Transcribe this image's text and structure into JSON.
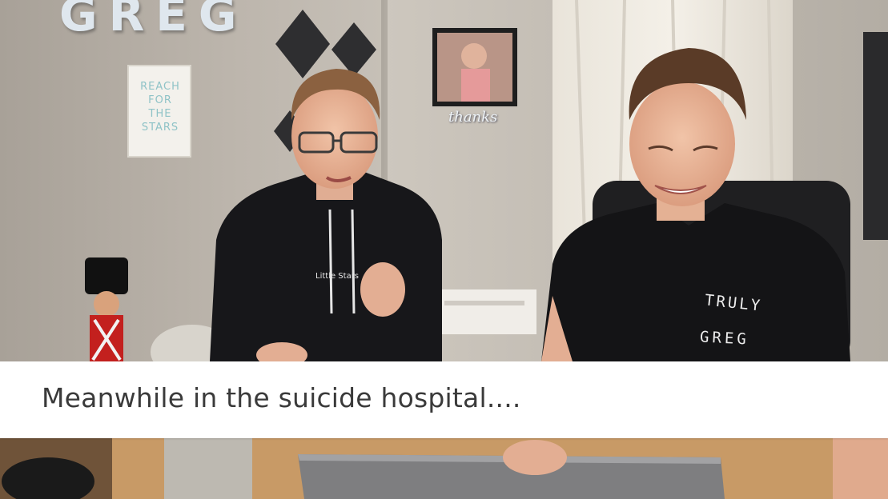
{
  "wall_letters": "GREG",
  "poster_text": "REACH FOR THE STARS",
  "frame_sign": "thanks",
  "hoodie_text": "Little Stars",
  "shirt_text": [
    "TRULY",
    "GREG"
  ],
  "caption": "Meanwhile in the suicide hospital...."
}
